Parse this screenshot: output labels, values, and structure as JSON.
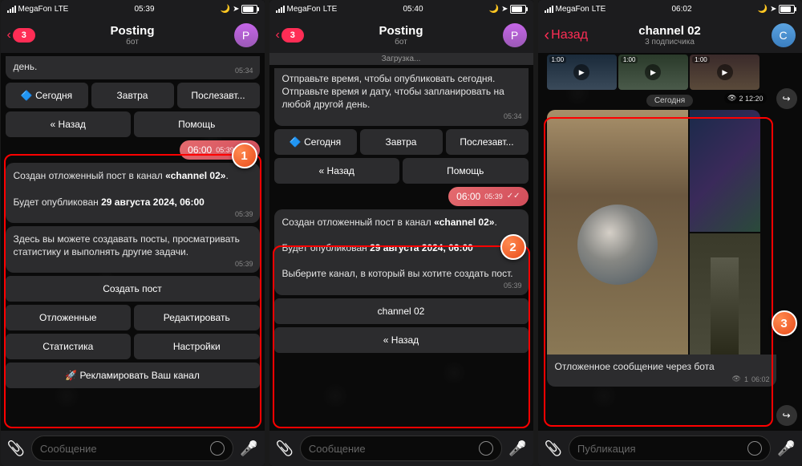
{
  "phones": [
    {
      "status": {
        "carrier": "MegaFon",
        "net": "LTE",
        "time": "05:39"
      },
      "header": {
        "back_badge": "3",
        "title": "Posting",
        "sub": "бот",
        "avatar": "P"
      },
      "top_msg": {
        "text": "день.",
        "time": "05:34"
      },
      "kb_top": [
        [
          "🔷 Сегодня",
          "Завтра",
          "Послезавт..."
        ],
        [
          "« Назад",
          "Помощь"
        ]
      ],
      "out": {
        "text": "06:00",
        "time": "05:39"
      },
      "msg1": {
        "l1": "Создан отложенный пост в канал ",
        "ch": "«channel 02»",
        "l2": "Будет опубликован ",
        "date": "29 августа 2024, 06:00",
        "time": "05:39"
      },
      "msg2": {
        "text": "Здесь вы можете создавать посты, просматривать статистику и выполнять другие задачи.",
        "time": "05:39"
      },
      "kb_bottom": [
        [
          "Создать пост"
        ],
        [
          "Отложенные",
          "Редактировать"
        ],
        [
          "Статистика",
          "Настройки"
        ],
        [
          "🚀 Рекламировать Ваш канал"
        ]
      ],
      "input_placeholder": "Сообщение",
      "step": "1"
    },
    {
      "status": {
        "carrier": "MegaFon",
        "net": "LTE",
        "time": "05:40"
      },
      "header": {
        "back_badge": "3",
        "title": "Posting",
        "sub": "бот",
        "avatar": "P"
      },
      "loading": "Загрузка...",
      "top_msg": {
        "text": "Отправьте время, чтобы опубликовать сегодня. Отправьте время и дату, чтобы запланировать на любой другой день.",
        "time": "05:34"
      },
      "kb_top": [
        [
          "🔷 Сегодня",
          "Завтра",
          "Послезавт..."
        ],
        [
          "« Назад",
          "Помощь"
        ]
      ],
      "out": {
        "text": "06:00",
        "time": "05:39"
      },
      "msg1": {
        "l1": "Создан отложенный пост в канал ",
        "ch": "«channel 02»",
        "l2": "Будет опубликован ",
        "date": "29 августа 2024, 06:00",
        "l3": "Выберите канал, в который вы хотите создать пост.",
        "time": "05:39"
      },
      "kb_bottom": [
        [
          "channel 02"
        ],
        [
          "« Назад"
        ]
      ],
      "input_placeholder": "Сообщение",
      "step": "2"
    },
    {
      "status": {
        "carrier": "MegaFon",
        "net": "LTE",
        "time": "06:02"
      },
      "header": {
        "back_text": "Назад",
        "title": "channel 02",
        "sub": "3 подписчика",
        "avatar": "С"
      },
      "media_durs": [
        "1:00",
        "1:00",
        "1:00"
      ],
      "media_views": "2 12:20",
      "date_chip": "Сегодня",
      "caption": "Отложенное сообщение через бота",
      "caption_meta": {
        "views": "1",
        "time": "06:02"
      },
      "input_placeholder": "Публикация",
      "step": "3"
    }
  ]
}
